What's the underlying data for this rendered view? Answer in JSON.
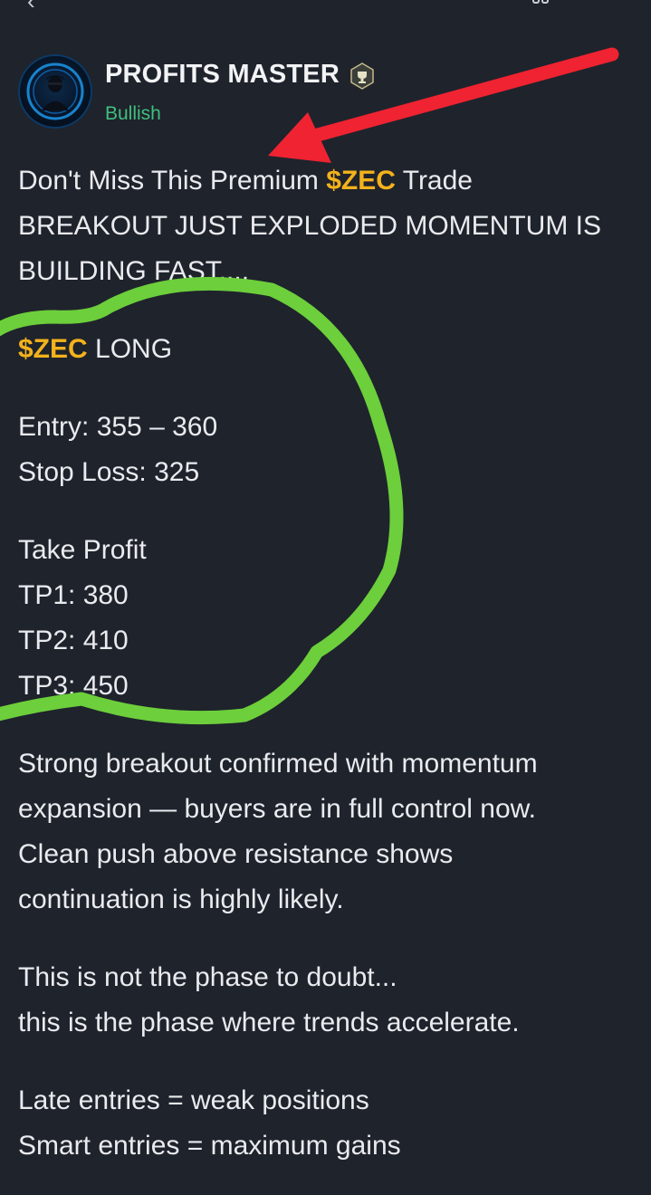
{
  "nav": {
    "back_icon": "back-arrow-icon",
    "menu_icon": "options-icon"
  },
  "author": {
    "name": "PROFITS MASTER",
    "badge_icon": "verified-trophy-badge-icon",
    "sentiment": "Bullish",
    "sentiment_color": "#3fbf7f"
  },
  "post": {
    "intro_prefix": "Don't Miss This Premium ",
    "intro_tag": "$ZEC",
    "intro_suffix": " Trade",
    "intro_line2": "BREAKOUT JUST EXPLODED MOMENTUM IS",
    "intro_line3": "BUILDING FAST....",
    "signal_tag": "$ZEC",
    "signal_side": " LONG",
    "entry": "Entry: 355 – 360",
    "stop_loss": "Stop Loss: 325",
    "take_profit_title": "Take Profit",
    "tp1": "TP1: 380",
    "tp2": "TP2: 410",
    "tp3": "TP3: 450",
    "para1": [
      "Strong breakout confirmed with momentum",
      "expansion — buyers are in full control now.",
      "Clean push above resistance shows",
      "continuation is highly likely."
    ],
    "para2": [
      "This is not the phase to doubt...",
      "this is the phase where trends accelerate."
    ],
    "para3": [
      "Late entries = weak positions",
      "Smart entries = maximum gains"
    ]
  },
  "annotations": {
    "arrow_color": "#ef2331",
    "circle_color": "#6ccf3b"
  },
  "colors": {
    "tag": "#f3b21c",
    "background": "#1f232c"
  }
}
